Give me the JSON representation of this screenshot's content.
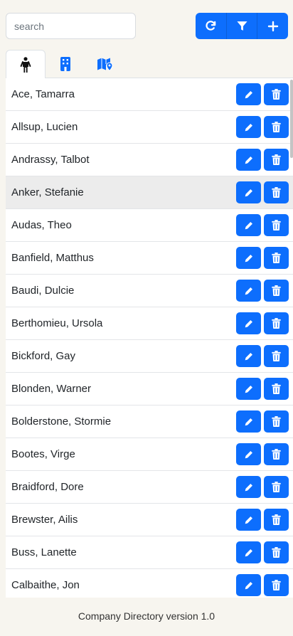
{
  "search": {
    "placeholder": "search",
    "value": ""
  },
  "toolbar": {
    "refresh_icon": "refresh-icon",
    "filter_icon": "filter-icon",
    "add_icon": "plus-icon"
  },
  "tabs": [
    {
      "icon": "person-icon",
      "active": true
    },
    {
      "icon": "building-icon",
      "active": false
    },
    {
      "icon": "map-location-icon",
      "active": false
    }
  ],
  "people": [
    "Ace, Tamarra",
    "Allsup, Lucien",
    "Andrassy, Talbot",
    "Anker, Stefanie",
    "Audas, Theo",
    "Banfield, Matthus",
    "Baudi, Dulcie",
    "Berthomieu, Ursola",
    "Bickford, Gay",
    "Blonden, Warner",
    "Bolderstone, Stormie",
    "Bootes, Virge",
    "Braidford, Dore",
    "Brewster, Ailis",
    "Buss, Lanette",
    "Calbaithe, Jon"
  ],
  "highlighted_row": 3,
  "colors": {
    "primary": "#0d6efd",
    "background": "#f7f5ef"
  },
  "footer": {
    "text": "Company Directory version 1.0"
  }
}
